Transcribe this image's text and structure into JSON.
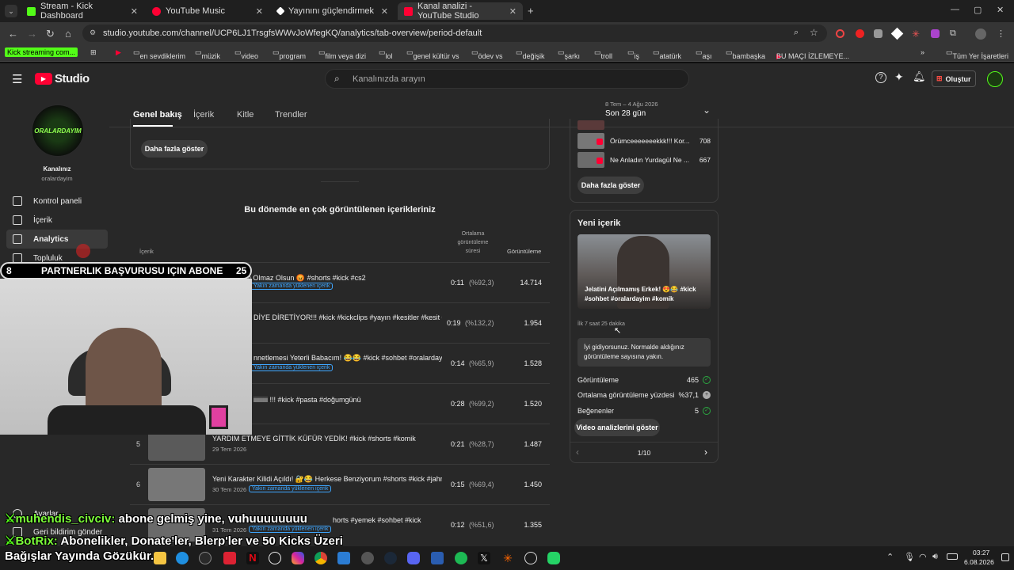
{
  "tabs": [
    {
      "label": "Stream - Kick Dashboard"
    },
    {
      "label": "YouTube Music"
    },
    {
      "label": "Yayınını güçlendirmek için en iy"
    },
    {
      "label": "Kanal analizi - YouTube Studio"
    }
  ],
  "url": "studio.youtube.com/channel/UCP6LJ1TrsgfsWWvJoWfegKQ/analytics/tab-overview/period-default",
  "bookmarks": [
    "Kick streaming com...",
    "en sevdiklerim",
    "müzik",
    "video",
    "program",
    "film veya dizi",
    "lol",
    "genel kültür vs",
    "ödev vs",
    "değişik",
    "şarkı",
    "troll",
    "iş",
    "atatürk",
    "aşı",
    "bambaşka",
    "BU MAÇI İZLEMEYE...",
    "Tüm Yer İşaretleri"
  ],
  "studio": {
    "logo": "Studio",
    "search_placeholder": "Kanalınızda arayın",
    "create_label": "Oluştur"
  },
  "channel": {
    "title": "Kanalınız",
    "handle": "oralardayim",
    "avatar_text": "ORALARDAYIM"
  },
  "sidebar": {
    "items": [
      {
        "label": "Kontrol paneli"
      },
      {
        "label": "İçerik"
      },
      {
        "label": "Analytics"
      },
      {
        "label": "Topluluk"
      },
      {
        "label": "Ayarlar"
      },
      {
        "label": "Geri bildirim gönder"
      }
    ]
  },
  "analytics_tabs": [
    "Genel bakış",
    "İçerik",
    "Kitle",
    "Trendler"
  ],
  "period": {
    "range": "8 Tem – 4 Ağu 2026",
    "label": "Son 28 gün"
  },
  "show_more": "Daha fazla göster",
  "top_content": {
    "heading": "Bu dönemde en çok görüntülenen içerikleriniz",
    "col_content": "İçerik",
    "col_duration": "Ortalama görüntüleme süresi",
    "col_views": "Görüntüleme",
    "rows": [
      {
        "rank": "",
        "title": "Böyle Takım Olmaz Olsun 😡 #shorts #kick #cs2",
        "date": "",
        "badge": "Yakın zamanda yüklenen içerik",
        "dur": "0:11",
        "pct": "(%92,3)",
        "views": "14.714"
      },
      {
        "rank": "",
        "title": "DİYE DİRETİYOR!!! #kick #kickclips #yayın #kesitler #kesit #k...",
        "date": "",
        "badge": "",
        "dur": "0:19",
        "pct": "(%132,2)",
        "views": "1.954"
      },
      {
        "rank": "",
        "title": "nnetlemesi Yeterli Babacım! 😂😂 #kick #sohbet #oralardayi...",
        "date": "",
        "badge": "Yakın zamanda yüklenen içerik",
        "dur": "0:14",
        "pct": "(%65,9)",
        "views": "1.528"
      },
      {
        "rank": "",
        "title": "iiiiiiiii !!! #kick #pasta #doğumgünü",
        "date": "",
        "badge": "",
        "dur": "0:28",
        "pct": "(%99,2)",
        "views": "1.520"
      },
      {
        "rank": "5",
        "title": "YARDIM ETMEYE GİTTİK KÜFÜR YEDİK! #kick #shorts #komik",
        "date": "29 Tem 2026",
        "badge": "",
        "dur": "0:21",
        "pct": "(%28,7)",
        "views": "1.487"
      },
      {
        "rank": "6",
        "title": "Yeni Karakter Kilidi Açıldı! 🔐😂 Herkese Benziyorum #shorts #kick #jahre...",
        "date": "30 Tem 2026",
        "badge": "Yakın zamanda yüklenen içerik",
        "dur": "0:15",
        "pct": "(%69,4)",
        "views": "1.450"
      },
      {
        "rank": "",
        "title": "horts #yemek #sohbet #kick",
        "date": "31 Tem 2026",
        "badge": "Yakın zamanda yüklenen içerik",
        "dur": "0:12",
        "pct": "(%51,6)",
        "views": "1.355"
      }
    ]
  },
  "realtime": {
    "items": [
      {
        "title": "Örümceeeeeeekkk!!! Kor...",
        "views": "708"
      },
      {
        "title": "Ne Anladın Yurdagül Ne ...",
        "views": "667"
      }
    ],
    "show_more": "Daha fazla göster"
  },
  "new_content": {
    "heading": "Yeni içerik",
    "video_title": "Jelatini Açılmamış Erkek! 😍😂 #kick #sohbet #oralardayim #komik",
    "since": "İlk 7 saat 25 dakika",
    "insight": "İyi gidiyorsunuz. Normalde aldığınız görüntüleme sayısına yakın.",
    "metrics": [
      {
        "label": "Görüntüleme",
        "value": "465"
      },
      {
        "label": "Ortalama görüntüleme yüzdesi",
        "value": "%37,1"
      },
      {
        "label": "Beğenenler",
        "value": "5"
      }
    ],
    "analytics_button": "Video analizlerini göster",
    "pager": "1/10"
  },
  "overlay": {
    "banner_left": "8",
    "banner_text": "PARTNERLIK BAŞVURUSU IÇIN ABONE",
    "banner_right": "25",
    "chat1_user": "muhendis_civciv:",
    "chat1_msg": "abone gelmiş yine, vuhuuuuuuuu",
    "chat2_user": "BotRix:",
    "chat2_msg": "Abonelikler, Donate'ler, Blerp'ler ve 50 Kicks Üzeri",
    "chat3": "Bağışlar Yayında Gözükür."
  },
  "clock": {
    "time": "03:27",
    "date": "6.08.2026"
  },
  "colors": {
    "accent": "#3ea6ff",
    "kick_green": "#53fc18",
    "yt_red": "#ff0033",
    "ok_green": "#2ba640"
  }
}
